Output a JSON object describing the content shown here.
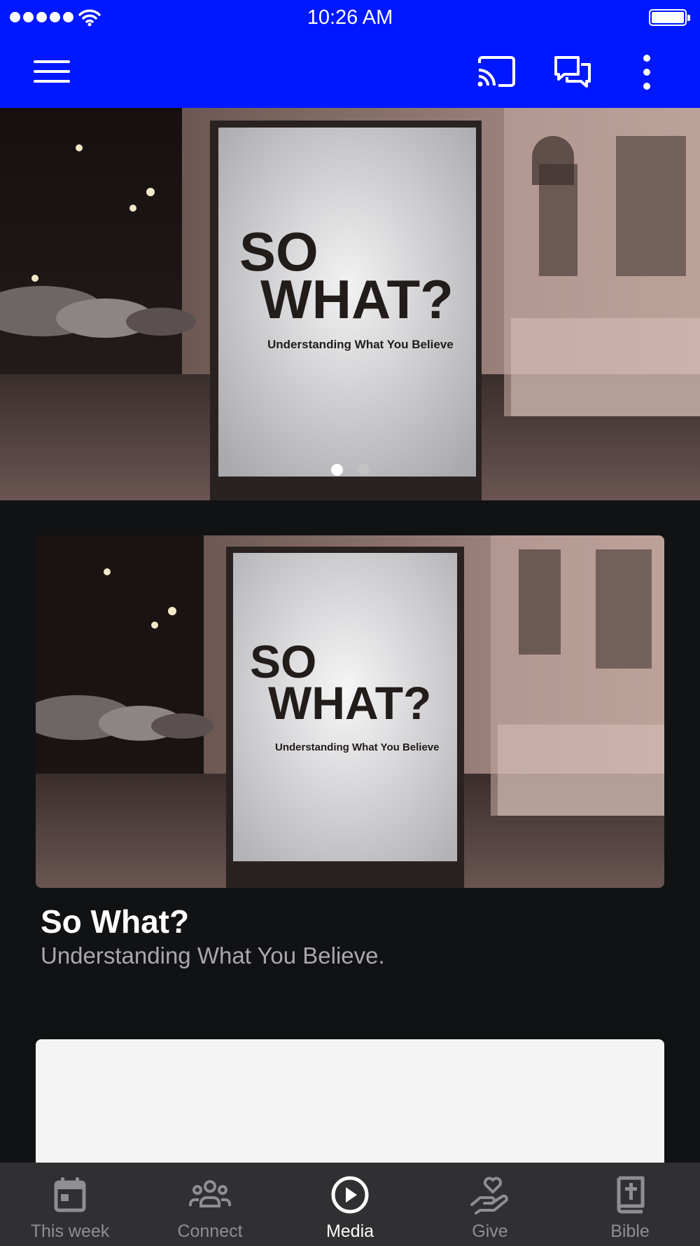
{
  "status_bar": {
    "time": "10:26 AM"
  },
  "app_bar": {
    "menu_icon": "hamburger-menu-icon",
    "actions": [
      "cast-icon",
      "chat-icon",
      "more-vertical-icon"
    ],
    "background": "#0018ff"
  },
  "hero": {
    "poster_title_line1": "SO",
    "poster_title_line2": "WHAT?",
    "poster_subtitle": "Understanding What You Believe",
    "carousel": {
      "total": 2,
      "active_index": 0
    }
  },
  "card": {
    "poster_title_line1": "SO",
    "poster_title_line2": "WHAT?",
    "poster_subtitle": "Understanding What You Believe",
    "title": "So What?",
    "subtitle": "Understanding What You Believe."
  },
  "tab_bar": {
    "tabs": [
      {
        "label": "This week",
        "icon": "calendar-icon",
        "active": false
      },
      {
        "label": "Connect",
        "icon": "people-group-icon",
        "active": false
      },
      {
        "label": "Media",
        "icon": "play-circle-icon",
        "active": true
      },
      {
        "label": "Give",
        "icon": "heart-hand-icon",
        "active": false
      },
      {
        "label": "Bible",
        "icon": "bible-book-icon",
        "active": false
      }
    ]
  }
}
